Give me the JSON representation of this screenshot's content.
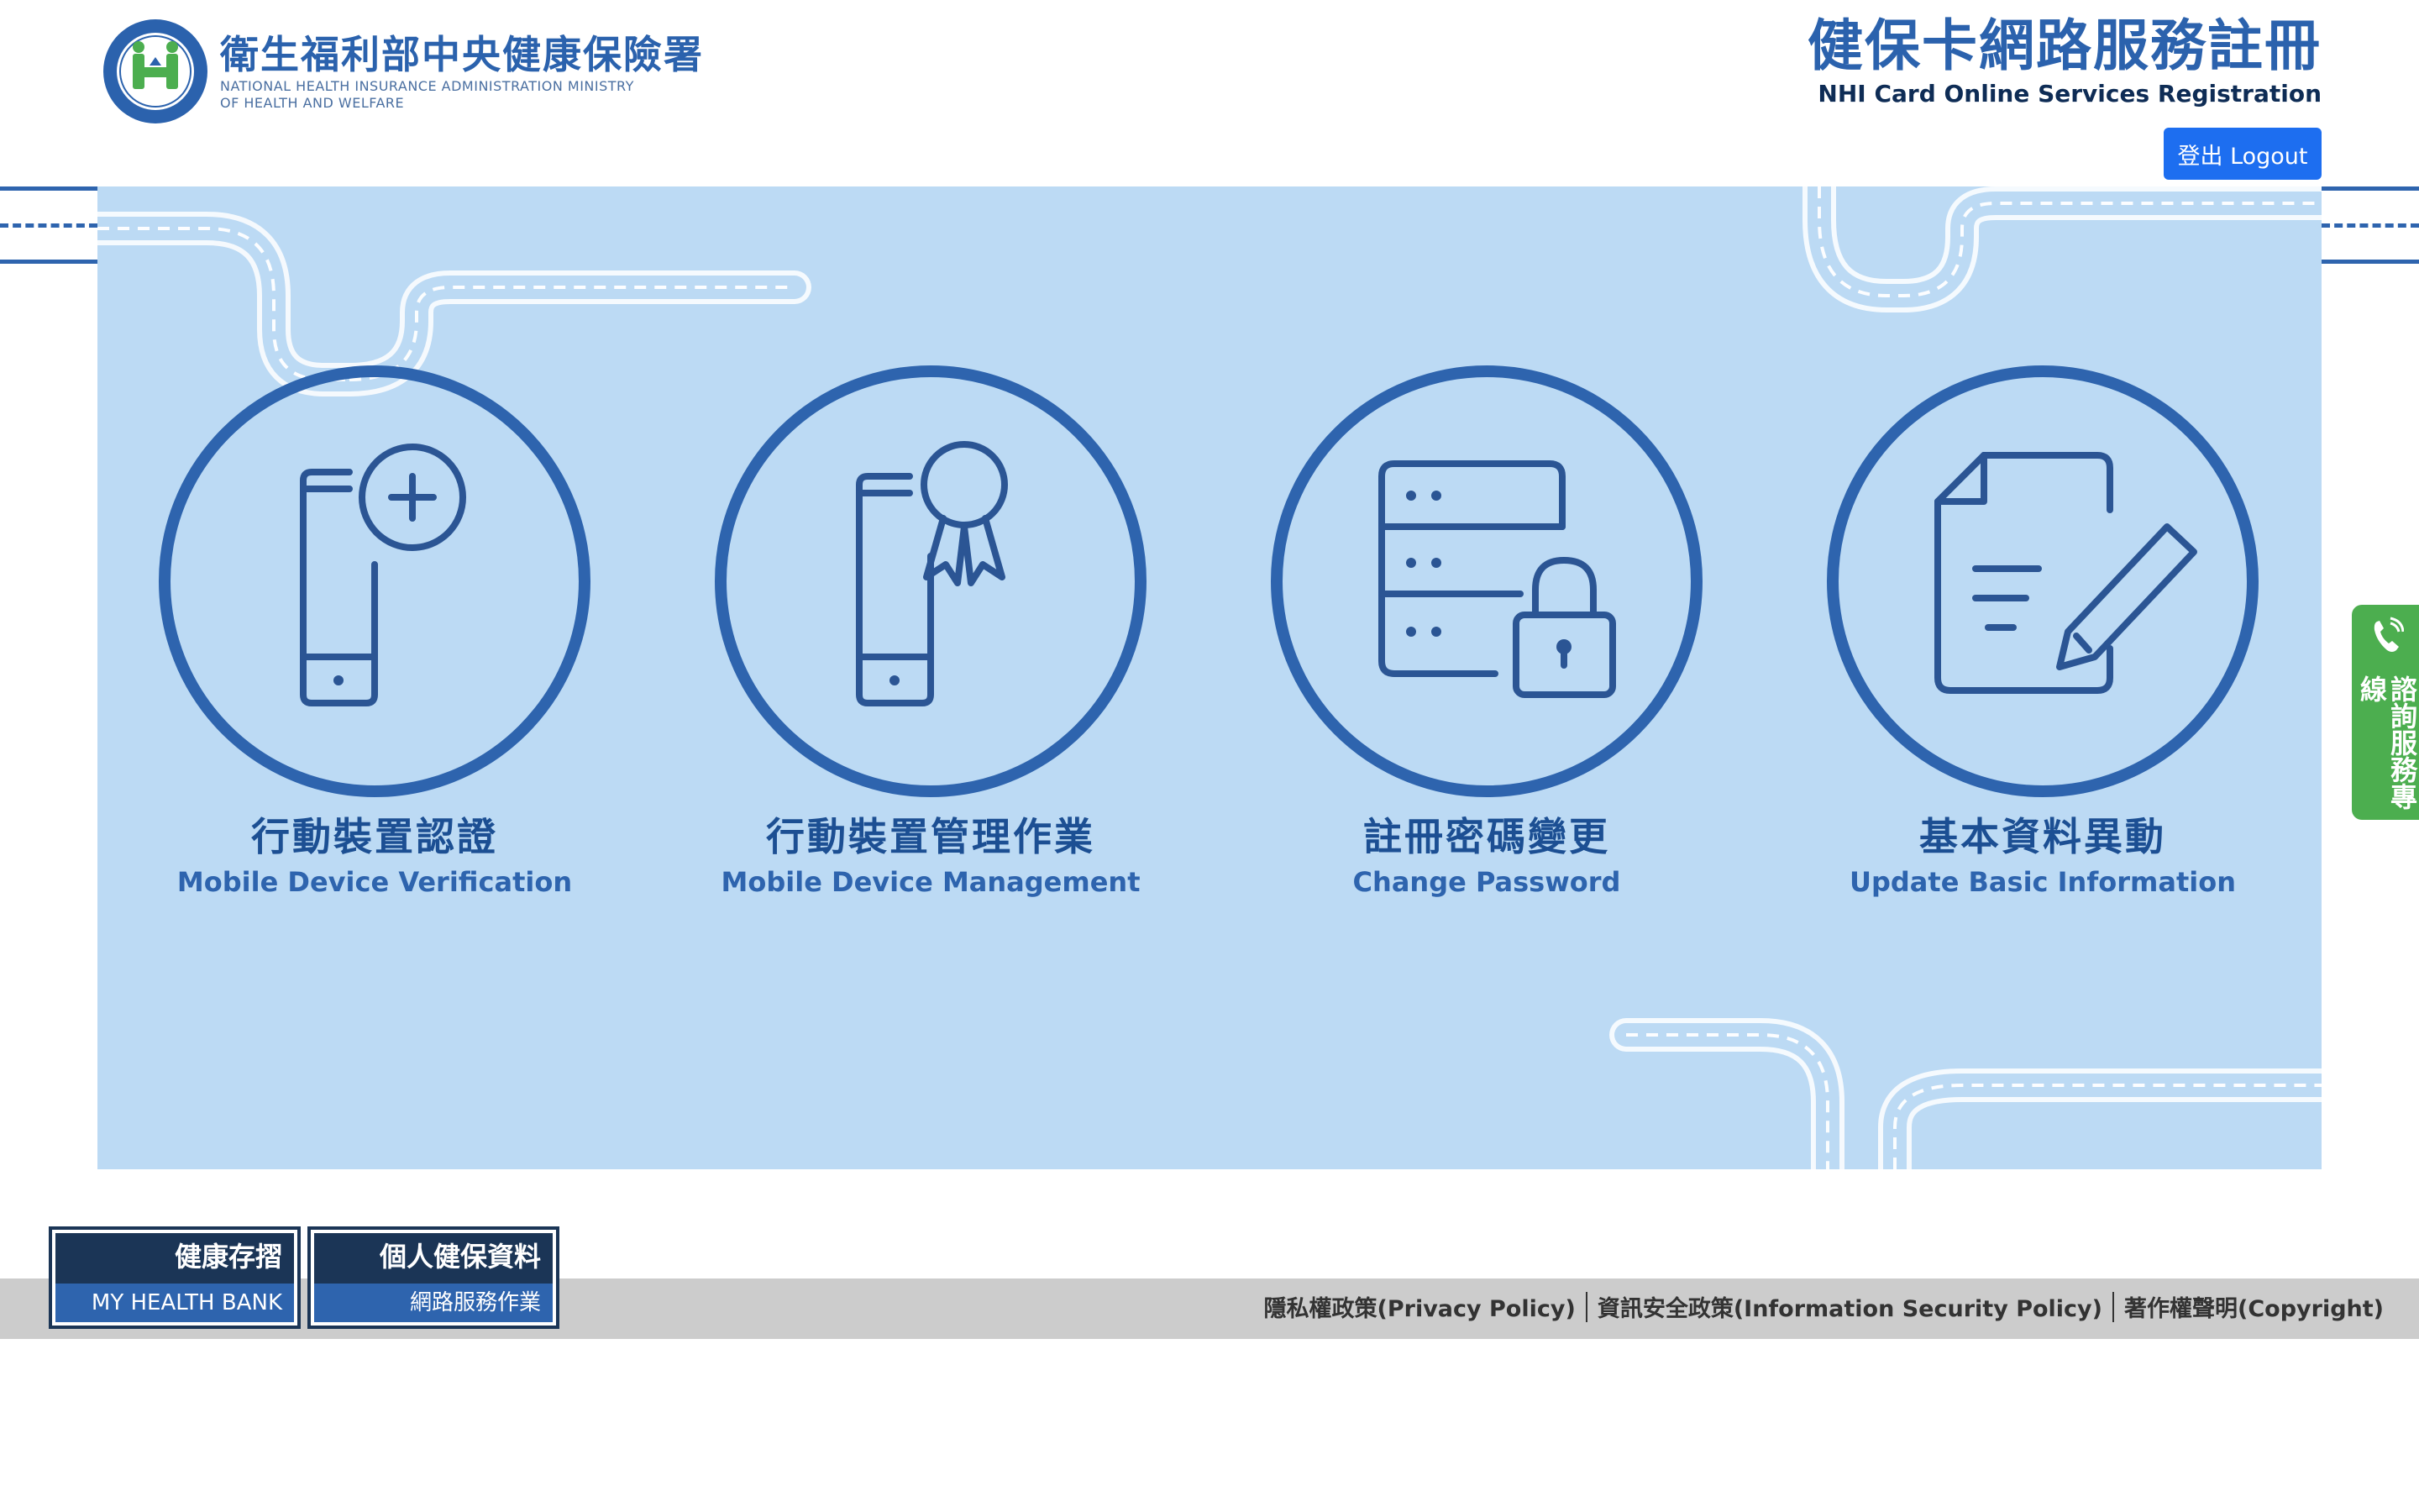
{
  "header": {
    "logo_zh": "衛生福利部中央健康保險署",
    "logo_en_line1": "NATIONAL HEALTH INSURANCE ADMINISTRATION MINISTRY",
    "logo_en_line2": "OF HEALTH AND WELFARE",
    "title_zh": "健保卡網路服務註冊",
    "title_en": "NHI Card Online Services Registration",
    "logout_label": "登出 Logout"
  },
  "services": [
    {
      "label_zh": "行動裝置認證",
      "label_en": "Mobile Device Verification",
      "icon": "phone-plus-icon"
    },
    {
      "label_zh": "行動裝置管理作業",
      "label_en": "Mobile Device Management",
      "icon": "phone-ribbon-icon"
    },
    {
      "label_zh": "註冊密碼變更",
      "label_en": "Change Password",
      "icon": "server-lock-icon"
    },
    {
      "label_zh": "基本資料異動",
      "label_en": "Update Basic Information",
      "icon": "document-edit-icon"
    }
  ],
  "hotline": {
    "label": "諮詢服務專線",
    "icon": "phone-icon"
  },
  "footer": {
    "bank1_top": "健康存摺",
    "bank1_bottom": "MY HEALTH BANK",
    "bank2_top": "個人健保資料",
    "bank2_bottom": "網路服務作業",
    "links": [
      "隱私權政策(Privacy Policy)",
      "資訊安全政策(Information Security Policy)",
      "著作權聲明(Copyright)"
    ]
  },
  "colors": {
    "brand_blue": "#2b62ad",
    "panel_bg": "#bcdaf4",
    "button_blue": "#1d6ef0",
    "hotline_green": "#4cae4f",
    "footer_gray": "#cccccc",
    "dark_navy": "#1b3556"
  }
}
